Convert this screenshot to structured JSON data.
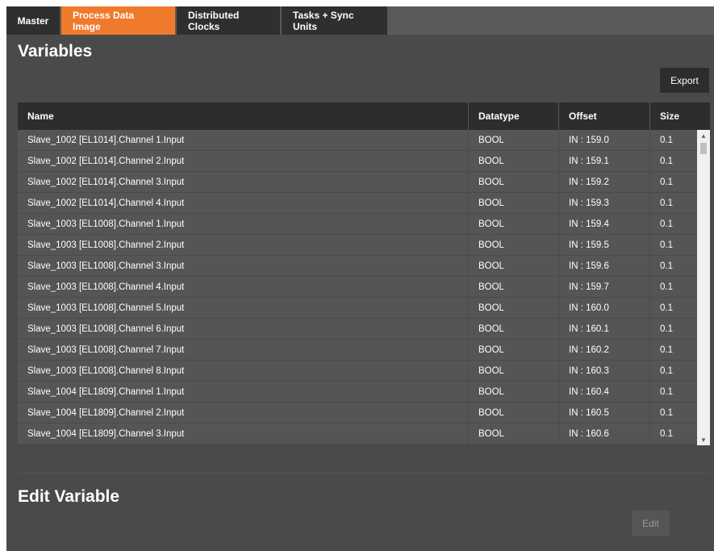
{
  "tabs": [
    {
      "label": "Master",
      "active": false
    },
    {
      "label": "Process Data Image",
      "active": true
    },
    {
      "label": "Distributed Clocks",
      "active": false
    },
    {
      "label": "Tasks + Sync Units",
      "active": false
    }
  ],
  "variables": {
    "title": "Variables",
    "export_label": "Export",
    "columns": [
      "Name",
      "Datatype",
      "Offset",
      "Size"
    ],
    "rows": [
      [
        "Slave_1002 [EL1014].Channel 1.Input",
        "BOOL",
        "IN : 159.0",
        "0.1"
      ],
      [
        "Slave_1002 [EL1014].Channel 2.Input",
        "BOOL",
        "IN : 159.1",
        "0.1"
      ],
      [
        "Slave_1002 [EL1014].Channel 3.Input",
        "BOOL",
        "IN : 159.2",
        "0.1"
      ],
      [
        "Slave_1002 [EL1014].Channel 4.Input",
        "BOOL",
        "IN : 159.3",
        "0.1"
      ],
      [
        "Slave_1003 [EL1008].Channel 1.Input",
        "BOOL",
        "IN : 159.4",
        "0.1"
      ],
      [
        "Slave_1003 [EL1008].Channel 2.Input",
        "BOOL",
        "IN : 159.5",
        "0.1"
      ],
      [
        "Slave_1003 [EL1008].Channel 3.Input",
        "BOOL",
        "IN : 159.6",
        "0.1"
      ],
      [
        "Slave_1003 [EL1008].Channel 4.Input",
        "BOOL",
        "IN : 159.7",
        "0.1"
      ],
      [
        "Slave_1003 [EL1008].Channel 5.Input",
        "BOOL",
        "IN : 160.0",
        "0.1"
      ],
      [
        "Slave_1003 [EL1008].Channel 6.Input",
        "BOOL",
        "IN : 160.1",
        "0.1"
      ],
      [
        "Slave_1003 [EL1008].Channel 7.Input",
        "BOOL",
        "IN : 160.2",
        "0.1"
      ],
      [
        "Slave_1003 [EL1008].Channel 8.Input",
        "BOOL",
        "IN : 160.3",
        "0.1"
      ],
      [
        "Slave_1004 [EL1809].Channel 1.Input",
        "BOOL",
        "IN : 160.4",
        "0.1"
      ],
      [
        "Slave_1004 [EL1809].Channel 2.Input",
        "BOOL",
        "IN : 160.5",
        "0.1"
      ],
      [
        "Slave_1004 [EL1809].Channel 3.Input",
        "BOOL",
        "IN : 160.6",
        "0.1"
      ]
    ]
  },
  "edit_variable": {
    "title": "Edit Variable",
    "edit_label": "Edit"
  },
  "icons": {
    "scroll_up": "scroll-up-icon",
    "scroll_down": "scroll-down-icon"
  },
  "colors": {
    "accent": "#f07a2c",
    "panel": "#4a4a4a",
    "header": "#2d2d2d",
    "row": "#555555"
  }
}
